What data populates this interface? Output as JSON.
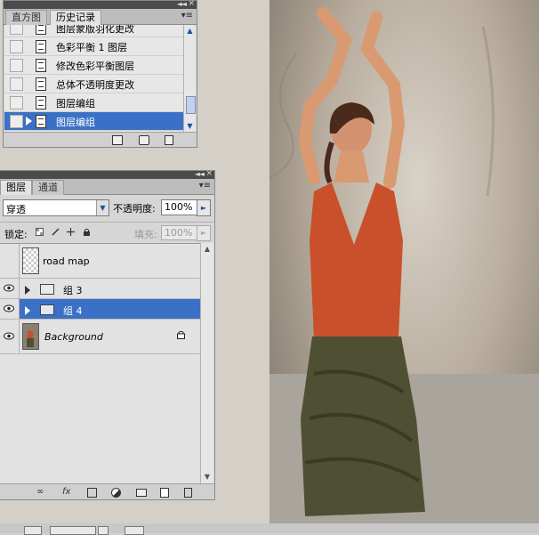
{
  "history_panel": {
    "tabs": [
      "直方图",
      "历史记录"
    ],
    "active_tab": 1,
    "items": [
      {
        "label": "图层蒙版羽化更改",
        "selected": false
      },
      {
        "label": "色彩平衡 1 图层",
        "selected": false
      },
      {
        "label": "修改色彩平衡图层",
        "selected": false
      },
      {
        "label": "总体不透明度更改",
        "selected": false
      },
      {
        "label": "图层编组",
        "selected": false
      },
      {
        "label": "图层编组",
        "selected": true
      }
    ],
    "footer_icons": [
      "new-document-from-state-icon",
      "camera-snapshot-icon",
      "trash-icon"
    ]
  },
  "layers_panel": {
    "tabs": [
      "图层",
      "通道"
    ],
    "active_tab": 0,
    "blend_mode": "穿透",
    "opacity_label": "不透明度:",
    "opacity_value": "100%",
    "lock_label": "锁定:",
    "fill_label": "填充:",
    "fill_value": "100%",
    "layers": [
      {
        "name": "road map",
        "visible": false,
        "kind": "layer",
        "selected": false,
        "italic": false
      },
      {
        "name": "组 3",
        "visible": true,
        "kind": "group",
        "selected": false,
        "italic": false
      },
      {
        "name": "组 4",
        "visible": true,
        "kind": "group",
        "selected": true,
        "italic": false
      },
      {
        "name": "Background",
        "visible": true,
        "kind": "background",
        "selected": false,
        "italic": true,
        "locked": true
      }
    ],
    "footer_icons": [
      "link-icon",
      "fx-icon",
      "mask-icon",
      "adjustment-icon",
      "group-folder-icon",
      "new-layer-icon",
      "trash-icon"
    ]
  },
  "colors": {
    "selection": "#3a71c6",
    "panel_bg": "#d6d6d6",
    "titlebar": "#4b4b4b",
    "top": "#c9502a",
    "skirt": "#4e4f33"
  }
}
